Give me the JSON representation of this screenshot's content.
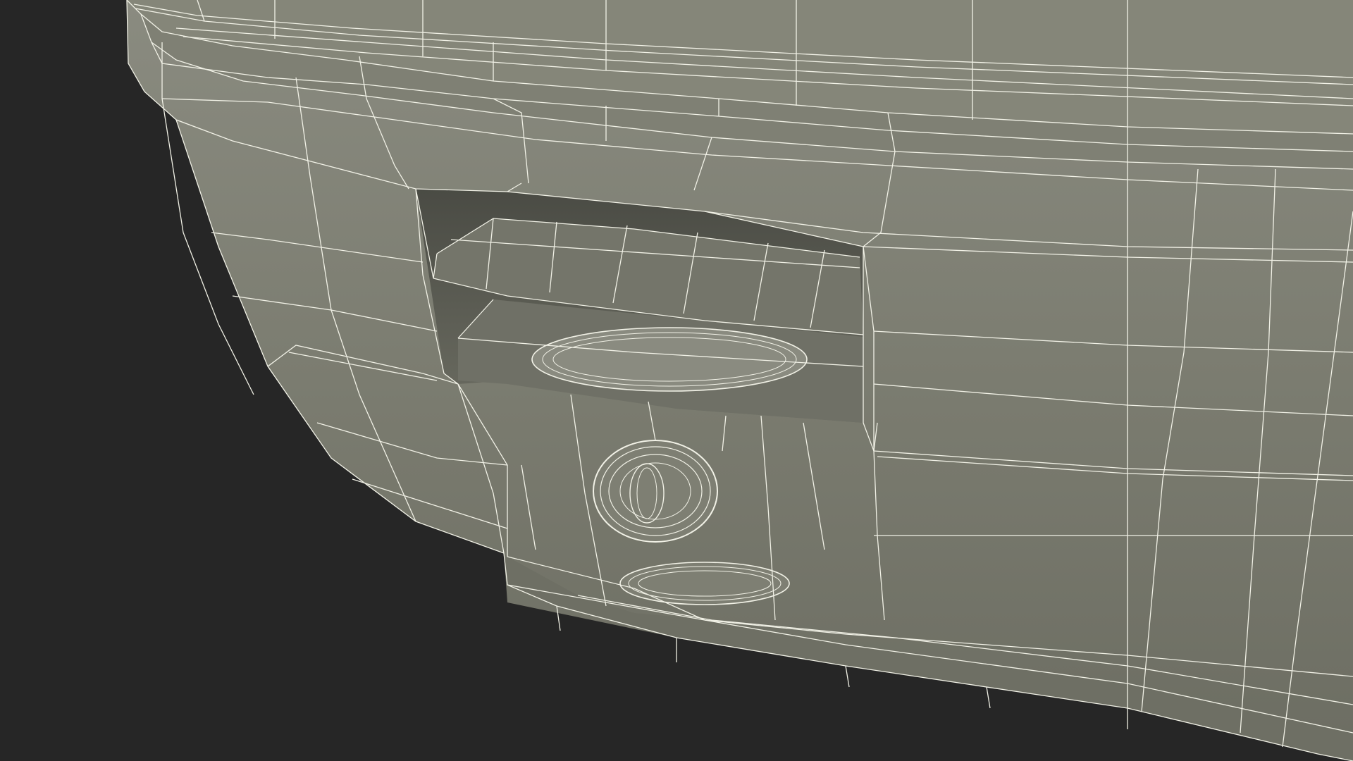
{
  "scene": {
    "background_color": "#262626",
    "surface_color": "#7b7c70",
    "surface_shadow_color": "#5d5e55",
    "surface_highlight_color": "#8a8b80",
    "wireframe_color": "#f1f1e6",
    "render_style": "wireframe-overlay-shaded"
  }
}
